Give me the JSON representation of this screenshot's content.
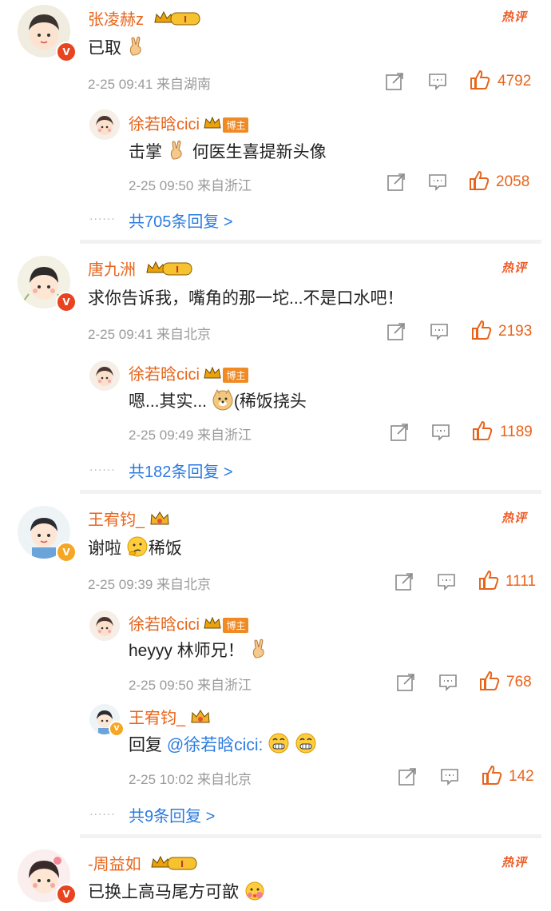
{
  "hot_label": "热评",
  "comments": [
    {
      "user": "张凌赫z",
      "badge": "I",
      "text": "已取",
      "time": "2-25 09:41",
      "location": "来自湖南",
      "likes": "4792",
      "reply": {
        "user": "徐若晗cici",
        "tag": "博主",
        "text": "击掌",
        "text2": "何医生喜提新头像",
        "time": "2-25 09:50",
        "location": "来自浙江",
        "likes": "2058"
      },
      "more": "共705条回复 >"
    },
    {
      "user": "唐九洲",
      "badge": "I",
      "text": "求你告诉我，嘴角的那一坨...不是口水吧！",
      "time": "2-25 09:41",
      "location": "来自北京",
      "likes": "2193",
      "reply": {
        "user": "徐若晗cici",
        "tag": "博主",
        "text": "嗯...其实...",
        "text2": "(稀饭挠头",
        "time": "2-25 09:49",
        "location": "来自浙江",
        "likes": "1189"
      },
      "more": "共182条回复 >"
    },
    {
      "user": "王宥钧_",
      "text": "谢啦",
      "text2": "稀饭",
      "time": "2-25 09:39",
      "location": "来自北京",
      "likes": "1111",
      "reply": {
        "user": "徐若晗cici",
        "tag": "博主",
        "text": "heyyy 林师兄！",
        "time": "2-25 09:50",
        "location": "来自浙江",
        "likes": "768"
      },
      "reply2": {
        "user": "王宥钧_",
        "text_prefix": "回复",
        "mention": "@徐若晗cici:",
        "time": "2-25 10:02",
        "location": "来自北京",
        "likes": "142"
      },
      "more": "共9条回复 >"
    },
    {
      "user": "-周益如",
      "badge": "I",
      "text": "已换上高马尾方可歆"
    }
  ],
  "dots": "......",
  "colors": {
    "accent": "#e8641b",
    "link": "#2b7be0",
    "meta": "#9a9a9a"
  }
}
